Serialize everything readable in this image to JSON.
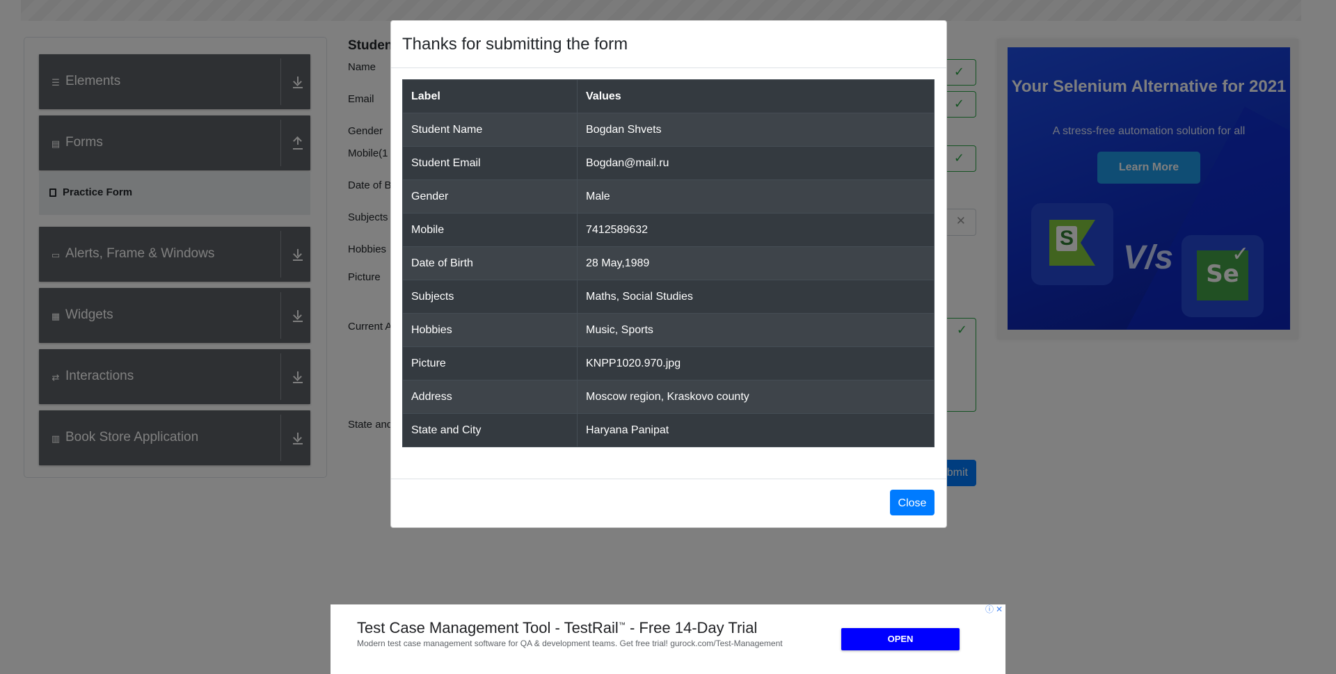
{
  "sidebar": {
    "groups": [
      {
        "label": "Elements",
        "icon": "list-icon",
        "arrow": "download-icon"
      },
      {
        "label": "Forms",
        "icon": "document-icon",
        "arrow": "upload-icon"
      },
      {
        "label": "Alerts, Frame & Windows",
        "icon": "window-icon",
        "arrow": "download-icon"
      },
      {
        "label": "Widgets",
        "icon": "grid-icon",
        "arrow": "download-icon"
      },
      {
        "label": "Interactions",
        "icon": "interaction-icon",
        "arrow": "download-icon"
      },
      {
        "label": "Book Store Application",
        "icon": "books-icon",
        "arrow": "download-icon"
      }
    ],
    "active_item": {
      "label": "Practice Form"
    }
  },
  "form": {
    "title": "Studen",
    "labels": {
      "name": "Name",
      "email": "Email",
      "gender": "Gender",
      "mobile": "Mobile(1",
      "dob": "Date of B",
      "subjects": "Subjects",
      "hobbies": "Hobbies",
      "picture": "Picture",
      "address": "Current A",
      "state": "State and"
    },
    "submit_label": "bmit"
  },
  "modal": {
    "title": "Thanks for submitting the form",
    "headers": [
      "Label",
      "Values"
    ],
    "rows": [
      [
        "Student Name",
        "Bogdan Shvets"
      ],
      [
        "Student Email",
        "Bogdan@mail.ru"
      ],
      [
        "Gender",
        "Male"
      ],
      [
        "Mobile",
        "7412589632"
      ],
      [
        "Date of Birth",
        "28 May,1989"
      ],
      [
        "Subjects",
        "Maths, Social Studies"
      ],
      [
        "Hobbies",
        "Music, Sports"
      ],
      [
        "Picture",
        "KNPP1020.970.jpg"
      ],
      [
        "Address",
        "Moscow region, Kraskovo county"
      ],
      [
        "State and City",
        "Haryana Panipat"
      ]
    ],
    "close_label": "Close"
  },
  "side_ad": {
    "title": "Your Selenium Alternative for 2021",
    "subtitle": "A stress-free automation solution for all",
    "button": "Learn More",
    "vs": "V/s",
    "s_logo": "S",
    "se_logo": "Se"
  },
  "bottom_ad": {
    "headline": "Test Case Management Tool - TestRail",
    "tm": "™",
    "headline_tail": " - Free 14-Day Trial",
    "description": "Modern test case management software for QA & development teams. Get free trial! gurock.com/Test-Management",
    "open_label": "OPEN",
    "info_icon": "ⓘ",
    "close_icon": "✕"
  },
  "colors": {
    "primary": "#007bff",
    "success": "#28a745",
    "table_dark": "#343a40",
    "sidebar_group": "#5d6166",
    "ad_button": "#0000ff"
  }
}
